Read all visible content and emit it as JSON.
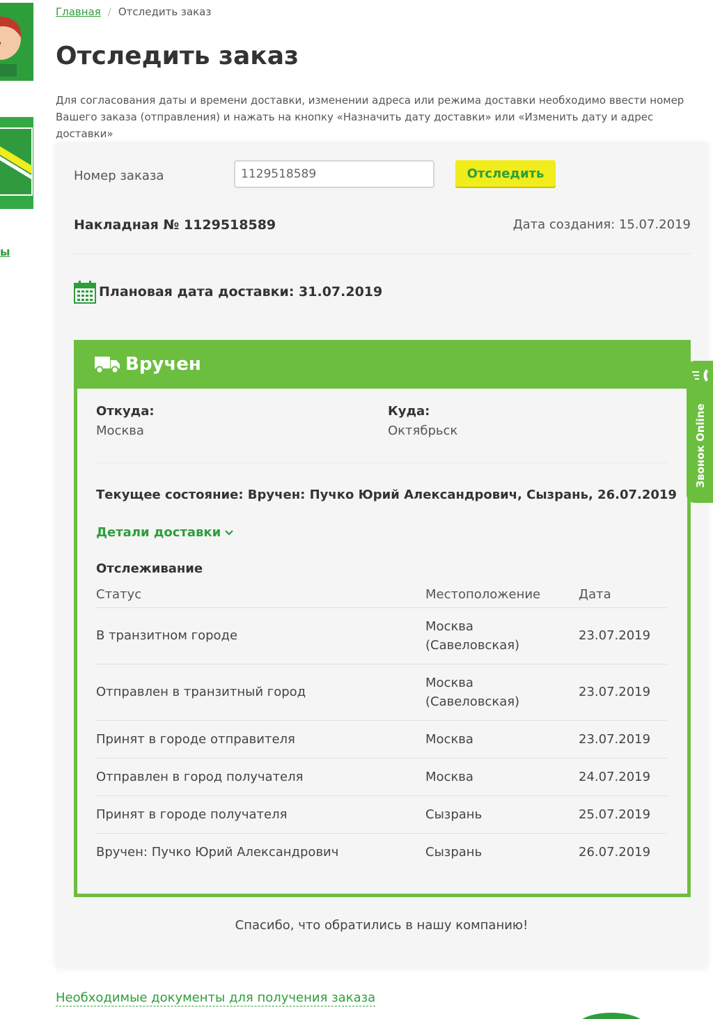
{
  "breadcrumb": {
    "home": "Главная",
    "current": "Отследить заказ"
  },
  "page_title": "Отследить заказ",
  "intro": "Для согласования даты и времени доставки, изменении адреса или режима доставки необходимо ввести номер Вашего заказа (отправления) и нажать на кнопку «Назначить дату доставки» или «Изменить дату и адрес доставки»",
  "form": {
    "order_label": "Номер заказа",
    "order_value": "1129518589",
    "track_button": "Отследить"
  },
  "invoice": {
    "number_text": "Накладная № 1129518589",
    "created_text": "Дата создания: 15.07.2019"
  },
  "planned_delivery": "Плановая дата доставки: 31.07.2019",
  "status": {
    "title": "Вручен",
    "from_label": "Откуда:",
    "from_value": "Москва",
    "to_label": "Куда:",
    "to_value": "Октябрьск",
    "current": "Текущее состояние: Вручен: Пучко Юрий Александрович, Сызрань, 26.07.2019",
    "details_link": "Детали доставки"
  },
  "tracking": {
    "title": "Отслеживание",
    "headers": [
      "Статус",
      "Местоположение",
      "Дата"
    ],
    "rows": [
      {
        "status": "В транзитном городе",
        "location_1": "Москва",
        "location_2": "(Савеловская)",
        "date": "23.07.2019"
      },
      {
        "status": "Отправлен в транзитный город",
        "location_1": "Москва",
        "location_2": "(Савеловская)",
        "date": "23.07.2019"
      },
      {
        "status": "Принят в городе отправителя",
        "location_1": "Москва",
        "location_2": "",
        "date": "23.07.2019"
      },
      {
        "status": "Отправлен в город получателя",
        "location_1": "Москва",
        "location_2": "",
        "date": "24.07.2019"
      },
      {
        "status": "Принят в городе получателя",
        "location_1": "Сызрань",
        "location_2": "",
        "date": "25.07.2019"
      },
      {
        "status": "Вручен: Пучко Юрий Александрович",
        "location_1": "Сызрань",
        "location_2": "",
        "date": "26.07.2019"
      }
    ]
  },
  "thanks": "Спасибо, что обратились в нашу компанию!",
  "call_tab": "Звонок Online",
  "docs_link": "Необходимые документы для получения заказа",
  "side_link_stub": "ы",
  "colors": {
    "brand_green": "#2e9e3b",
    "status_green": "#6cbe3f",
    "button_yellow": "#f1ec1b"
  }
}
